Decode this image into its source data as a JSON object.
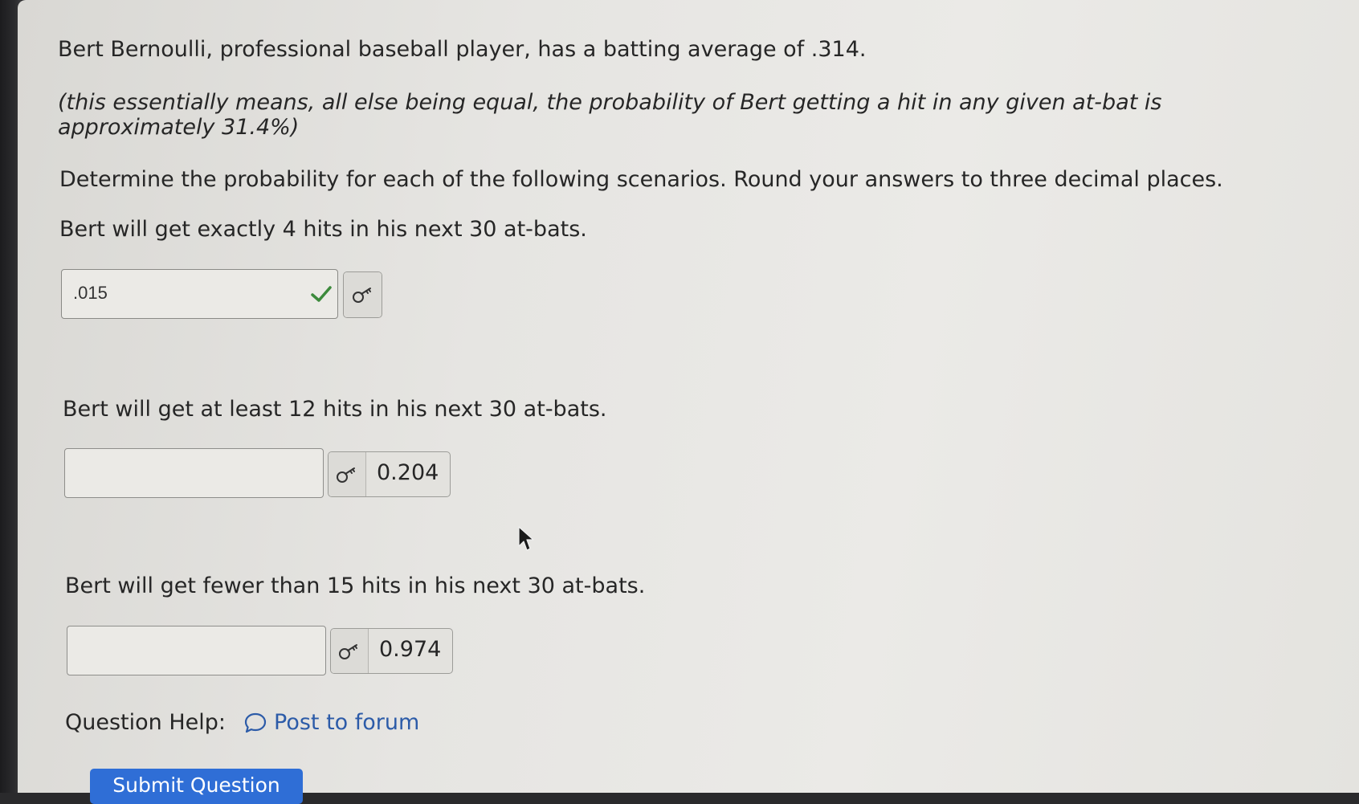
{
  "problem": {
    "intro": "Bert Bernoulli, professional baseball player, has a batting average of .314.",
    "note_line1": "(this essentially means, all else being equal, the probability of Bert getting a hit in any given at-bat is",
    "note_line2": "approximately 31.4%)",
    "instructions": "Determine the probability for each of the following scenarios.  Round your answers to three decimal places."
  },
  "questions": [
    {
      "prompt": "Bert will get exactly 4 hits in his next 30 at-bats.",
      "answer_value": ".015",
      "status": "correct",
      "hint_value": ""
    },
    {
      "prompt": "Bert will get at least 12 hits in his next 30 at-bats.",
      "answer_value": "",
      "hint_value": "0.204"
    },
    {
      "prompt": "Bert will get fewer than 15 hits in his next 30 at-bats.",
      "answer_value": "",
      "hint_value": "0.974"
    }
  ],
  "help": {
    "label": "Question Help:",
    "forum_link": "Post to forum"
  },
  "submit": {
    "label": "Submit Question"
  },
  "colors": {
    "link": "#2c5ba8",
    "submit_bg": "#2f6ed6",
    "check": "#3c8a3c"
  },
  "icons": {
    "hint": "key-icon",
    "correct": "checkmark-icon",
    "forum": "speech-bubble-icon"
  }
}
